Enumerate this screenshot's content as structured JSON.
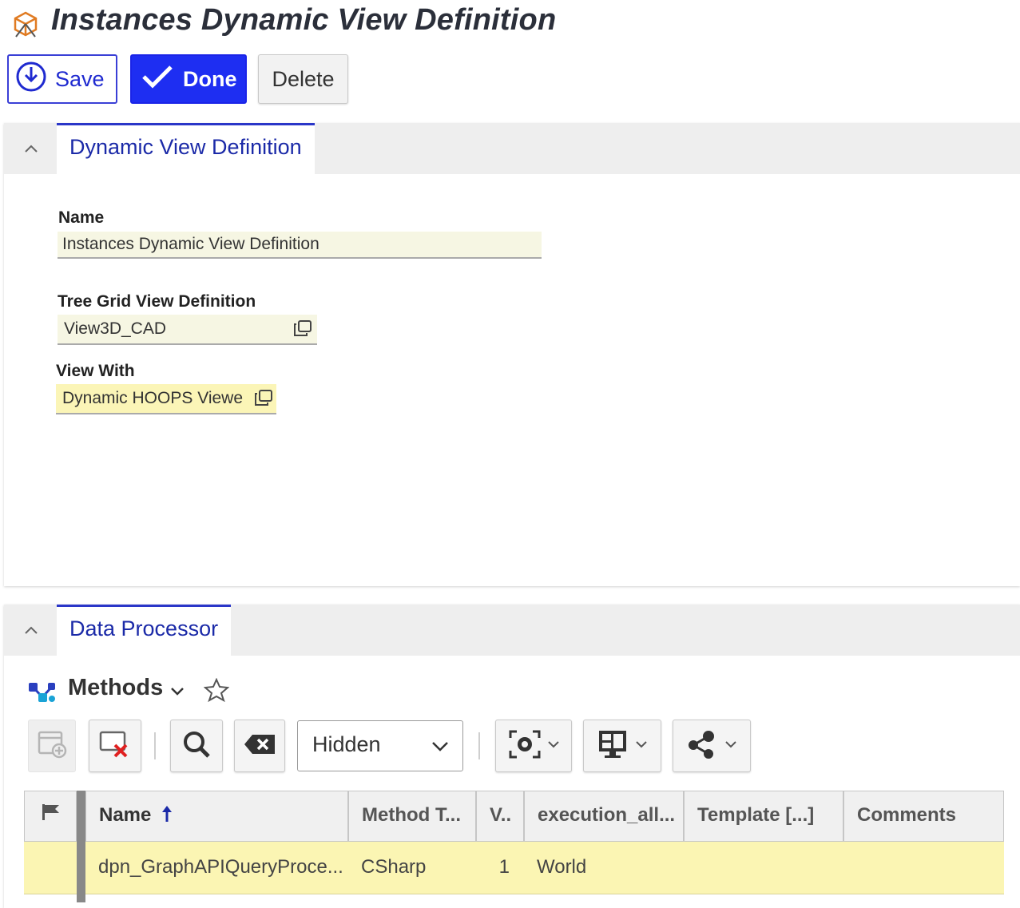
{
  "page": {
    "title": "Instances Dynamic View Definition"
  },
  "toolbar": {
    "save_label": "Save",
    "done_label": "Done",
    "delete_label": "Delete"
  },
  "dynamic_view_panel": {
    "tab_label": "Dynamic View Definition",
    "fields": {
      "name": {
        "label": "Name",
        "value": "Instances Dynamic View Definition"
      },
      "tree_grid": {
        "label": "Tree Grid View Definition",
        "value": "View3D_CAD"
      },
      "view_with": {
        "label": "View With",
        "value": "Dynamic HOOPS Viewe"
      }
    }
  },
  "data_processor_panel": {
    "tab_label": "Data Processor",
    "grid_title": "Methods",
    "filter_select": {
      "selected": "Hidden"
    },
    "columns": [
      "Name",
      "Method T...",
      "V..",
      "execution_all...",
      "Template [...]",
      "Comments"
    ],
    "rows": [
      {
        "name": "dpn_GraphAPIQueryProce...",
        "method_type": "CSharp",
        "version": "1",
        "execution": "World",
        "template": "",
        "comments": ""
      }
    ]
  },
  "colors": {
    "accent": "#1e2ef2",
    "tab_text": "#1b2aa8",
    "row_highlight": "#fbf5b3",
    "field_bg": "#f6f6e3"
  }
}
